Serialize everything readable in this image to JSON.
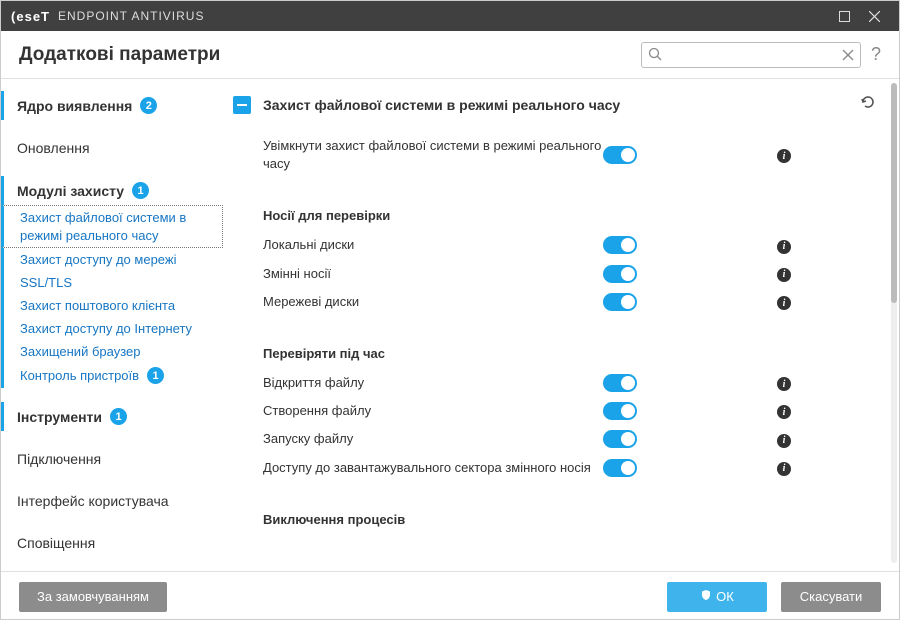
{
  "titlebar": {
    "brand_prefix": "es",
    "brand_e": "e",
    "brand_suffix": "T",
    "product": "ENDPOINT ANTIVIRUS"
  },
  "header": {
    "title": "Додаткові параметри",
    "search_placeholder": "",
    "help": "?"
  },
  "sidebar": {
    "items": [
      {
        "label": "Ядро виявлення",
        "badge": "2",
        "type": "item",
        "active": true
      },
      {
        "label": "Оновлення",
        "type": "item"
      },
      {
        "label": "Модулі захисту",
        "badge": "1",
        "type": "item",
        "active": true
      },
      {
        "label": "Захист файлової системи в режимі реального часу",
        "type": "sub",
        "selected": true
      },
      {
        "label": "Захист доступу до мережі",
        "type": "sub"
      },
      {
        "label": "SSL/TLS",
        "type": "sub"
      },
      {
        "label": "Захист поштового клієнта",
        "type": "sub"
      },
      {
        "label": "Захист доступу до Інтернету",
        "type": "sub"
      },
      {
        "label": "Захищений браузер",
        "type": "sub"
      },
      {
        "label": "Контроль пристроїв",
        "badge": "1",
        "type": "sub"
      },
      {
        "label": "Інструменти",
        "badge": "1",
        "type": "item",
        "active": true
      },
      {
        "label": "Підключення",
        "type": "item"
      },
      {
        "label": "Інтерфейс користувача",
        "type": "item"
      },
      {
        "label": "Сповіщення",
        "type": "item"
      }
    ]
  },
  "main": {
    "section_title": "Захист файлової системи в режимі реального часу",
    "enable_row": "Увімкнути захист файлової системи в режимі реального часу",
    "group1_title": "Носії для перевірки",
    "group1": [
      {
        "label": "Локальні диски"
      },
      {
        "label": "Змінні носії"
      },
      {
        "label": "Мережеві диски"
      }
    ],
    "group2_title": "Перевіряти під час",
    "group2": [
      {
        "label": "Відкриття файлу"
      },
      {
        "label": "Створення файлу"
      },
      {
        "label": "Запуску файлу"
      },
      {
        "label": "Доступу до завантажувального сектора змінного носія"
      }
    ],
    "group3_title": "Виключення процесів"
  },
  "footer": {
    "defaults": "За замовчуванням",
    "ok": "ОК",
    "cancel": "Скасувати"
  }
}
